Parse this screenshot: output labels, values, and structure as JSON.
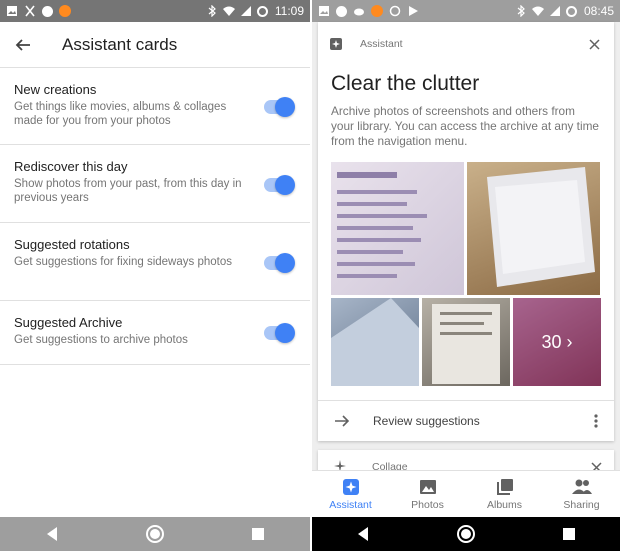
{
  "left": {
    "status_bar": {
      "time": "11:09"
    },
    "app_bar": {
      "title": "Assistant cards"
    },
    "settings": [
      {
        "title": "New creations",
        "description": "Get things like movies, albums & collages made for you from your photos",
        "enabled": true
      },
      {
        "title": "Rediscover this day",
        "description": "Show photos from your past, from this day in previous years",
        "enabled": true
      },
      {
        "title": "Suggested rotations",
        "description": "Get suggestions for fixing sideways photos",
        "enabled": true
      },
      {
        "title": "Suggested Archive",
        "description": "Get suggestions to archive photos",
        "enabled": true
      }
    ]
  },
  "right": {
    "status_bar": {
      "time": "08:45"
    },
    "card": {
      "label": "Assistant",
      "title": "Clear the clutter",
      "description": "Archive photos of screenshots and others from your library. You can access the archive at any time from the navigation menu.",
      "more_count": "30 ›",
      "action": "Review suggestions"
    },
    "next_card": {
      "label": "Collage"
    },
    "bottom_nav": [
      {
        "label": "Assistant",
        "icon": "assistant-icon",
        "active": true
      },
      {
        "label": "Photos",
        "icon": "photos-icon",
        "active": false
      },
      {
        "label": "Albums",
        "icon": "albums-icon",
        "active": false
      },
      {
        "label": "Sharing",
        "icon": "sharing-icon",
        "active": false
      }
    ]
  },
  "colors": {
    "accent": "#3f81f5",
    "toggle_track": "#a9c6f7"
  }
}
